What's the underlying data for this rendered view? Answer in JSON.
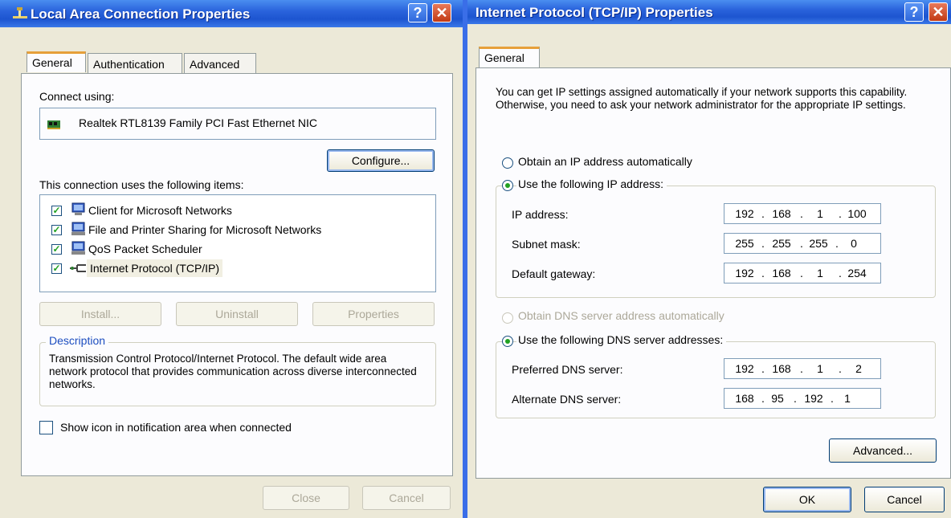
{
  "left_window": {
    "title": "Local Area Connection Properties",
    "help_glyph": "?",
    "close_glyph": "✕",
    "tabs": [
      "General",
      "Authentication",
      "Advanced"
    ],
    "connect_using_label": "Connect using:",
    "adapter_name": "Realtek RTL8139 Family PCI Fast Ethernet NIC",
    "configure_button": "Configure...",
    "items_label": "This connection uses the following items:",
    "items": [
      {
        "label": "Client for Microsoft Networks",
        "checked": true,
        "icon": "network-client-icon"
      },
      {
        "label": "File and Printer Sharing for Microsoft Networks",
        "checked": true,
        "icon": "network-service-icon"
      },
      {
        "label": "QoS Packet Scheduler",
        "checked": true,
        "icon": "network-service-icon"
      },
      {
        "label": "Internet Protocol (TCP/IP)",
        "checked": true,
        "icon": "protocol-icon"
      }
    ],
    "install_button": "Install...",
    "uninstall_button": "Uninstall",
    "properties_button": "Properties",
    "description_title": "Description",
    "description_text": "Transmission Control Protocol/Internet Protocol. The default wide area network protocol that provides communication across diverse interconnected networks.",
    "show_icon_label": "Show icon in notification area when connected",
    "close_button": "Close",
    "cancel_button": "Cancel"
  },
  "right_window": {
    "title": "Internet Protocol (TCP/IP) Properties",
    "help_glyph": "?",
    "close_glyph": "✕",
    "tab": "General",
    "intro_text": "You can get IP settings assigned automatically if your network supports this capability. Otherwise, you need to ask your network administrator for the appropriate IP settings.",
    "obtain_ip_auto": "Obtain an IP address automatically",
    "use_following_ip": "Use the following IP address:",
    "ip_address_label": "IP address:",
    "ip_address": [
      "192",
      "168",
      "1",
      "100"
    ],
    "subnet_mask_label": "Subnet mask:",
    "subnet_mask": [
      "255",
      "255",
      "255",
      "0"
    ],
    "default_gateway_label": "Default gateway:",
    "default_gateway": [
      "192",
      "168",
      "1",
      "254"
    ],
    "obtain_dns_auto": "Obtain DNS server address automatically",
    "use_following_dns": "Use the following DNS server addresses:",
    "preferred_dns_label": "Preferred DNS server:",
    "preferred_dns": [
      "192",
      "168",
      "1",
      "2"
    ],
    "alternate_dns_label": "Alternate DNS server:",
    "alternate_dns": [
      "168",
      "95",
      "192",
      "1"
    ],
    "advanced_button": "Advanced...",
    "ok_button": "OK",
    "cancel_button": "Cancel",
    "dot": "."
  },
  "colors": {
    "titlebar": "#2a63dc",
    "dialog_bg": "#ece9d8",
    "tab_highlight": "#e6a03a",
    "radio_dot": "#21a121",
    "description_title": "#1d4ec0"
  }
}
